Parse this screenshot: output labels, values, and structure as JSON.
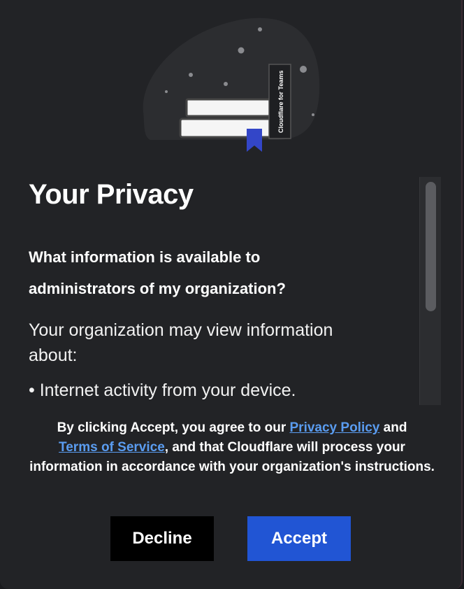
{
  "illustration": {
    "book_spine_label": "Cloudflare for Teams"
  },
  "content": {
    "title": "Your Privacy",
    "question": "What information is available to administrators of my organization?",
    "paragraph": "Your organization may view information about:",
    "bullet_1": "• Internet activity from your device."
  },
  "footer": {
    "prefix": "By clicking Accept, you agree to our ",
    "privacy_link": "Privacy Policy",
    "and": " and",
    "terms_link": "Terms of Service",
    "suffix": ", and that Cloudflare will process your information in accordance with your organization's instructions."
  },
  "buttons": {
    "decline": "Decline",
    "accept": "Accept"
  },
  "colors": {
    "background": "#222326",
    "accent": "#2155d4",
    "link": "#5a9cf0",
    "bookmark": "#3346c8"
  }
}
